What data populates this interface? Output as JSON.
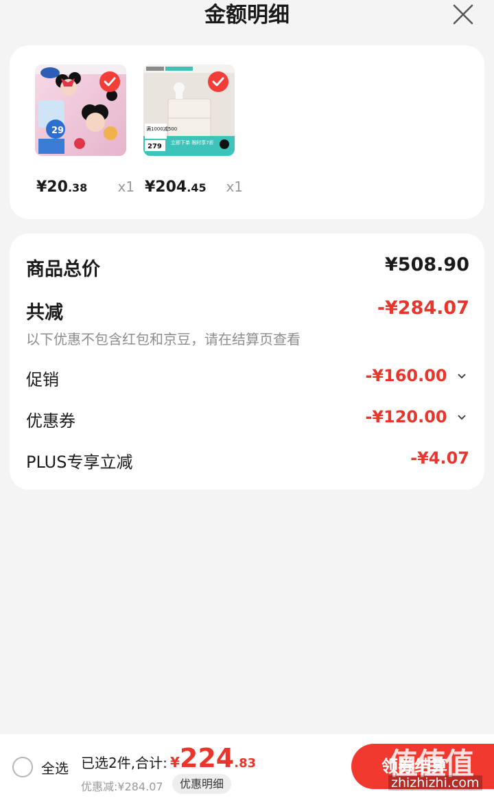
{
  "header": {
    "title": "金额明细"
  },
  "products": [
    {
      "name": "Disney毯子",
      "price_int": "¥20",
      "price_dec": ".38",
      "qty": "x1"
    },
    {
      "name": "床头柜",
      "price_int": "¥204",
      "price_dec": ".45",
      "qty": "x1"
    }
  ],
  "thumb_text": {
    "p1_badge": "29",
    "p2_line1": "满1000减500",
    "p2_price": "279",
    "p2_promo": "立即下单 限时享7折"
  },
  "summary": {
    "total_label": "商品总价",
    "total_value": "¥508.90",
    "discount_label": "共减",
    "discount_value": "-¥284.07",
    "note": "以下优惠不包含红包和京豆，请在结算页查看",
    "items": [
      {
        "label": "促销",
        "value": "-¥160.00",
        "expandable": true
      },
      {
        "label": "优惠券",
        "value": "-¥120.00",
        "expandable": true
      },
      {
        "label": "PLUS专享立减",
        "value": "-¥4.07",
        "expandable": false
      }
    ]
  },
  "bottom": {
    "select_all": "全选",
    "selected_text": "已选2件,合计:",
    "total_currency": "¥",
    "total_int": "224",
    "total_dec": ".83",
    "saved": "优惠减:¥284.07",
    "detail_btn": "优惠明细",
    "checkout": "领券结算",
    "watermark": "值值值",
    "watermark_url": "zhizhizhi.com"
  },
  "colors": {
    "accent": "#e8362d",
    "checkout_bg": "#f2392f",
    "bg": "#f4f4f4"
  }
}
